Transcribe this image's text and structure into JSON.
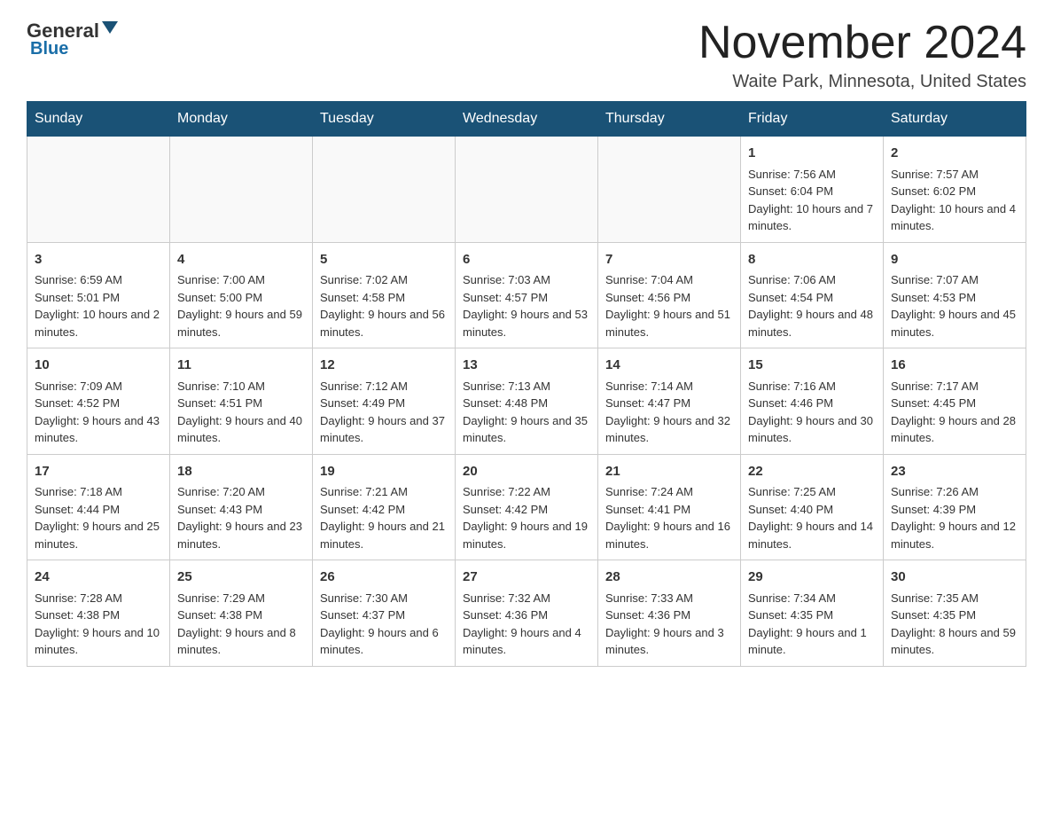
{
  "header": {
    "logo_general": "General",
    "logo_blue": "Blue",
    "month_title": "November 2024",
    "location": "Waite Park, Minnesota, United States"
  },
  "days_of_week": [
    "Sunday",
    "Monday",
    "Tuesday",
    "Wednesday",
    "Thursday",
    "Friday",
    "Saturday"
  ],
  "weeks": [
    [
      {
        "day": "",
        "info": ""
      },
      {
        "day": "",
        "info": ""
      },
      {
        "day": "",
        "info": ""
      },
      {
        "day": "",
        "info": ""
      },
      {
        "day": "",
        "info": ""
      },
      {
        "day": "1",
        "info": "Sunrise: 7:56 AM\nSunset: 6:04 PM\nDaylight: 10 hours and 7 minutes."
      },
      {
        "day": "2",
        "info": "Sunrise: 7:57 AM\nSunset: 6:02 PM\nDaylight: 10 hours and 4 minutes."
      }
    ],
    [
      {
        "day": "3",
        "info": "Sunrise: 6:59 AM\nSunset: 5:01 PM\nDaylight: 10 hours and 2 minutes."
      },
      {
        "day": "4",
        "info": "Sunrise: 7:00 AM\nSunset: 5:00 PM\nDaylight: 9 hours and 59 minutes."
      },
      {
        "day": "5",
        "info": "Sunrise: 7:02 AM\nSunset: 4:58 PM\nDaylight: 9 hours and 56 minutes."
      },
      {
        "day": "6",
        "info": "Sunrise: 7:03 AM\nSunset: 4:57 PM\nDaylight: 9 hours and 53 minutes."
      },
      {
        "day": "7",
        "info": "Sunrise: 7:04 AM\nSunset: 4:56 PM\nDaylight: 9 hours and 51 minutes."
      },
      {
        "day": "8",
        "info": "Sunrise: 7:06 AM\nSunset: 4:54 PM\nDaylight: 9 hours and 48 minutes."
      },
      {
        "day": "9",
        "info": "Sunrise: 7:07 AM\nSunset: 4:53 PM\nDaylight: 9 hours and 45 minutes."
      }
    ],
    [
      {
        "day": "10",
        "info": "Sunrise: 7:09 AM\nSunset: 4:52 PM\nDaylight: 9 hours and 43 minutes."
      },
      {
        "day": "11",
        "info": "Sunrise: 7:10 AM\nSunset: 4:51 PM\nDaylight: 9 hours and 40 minutes."
      },
      {
        "day": "12",
        "info": "Sunrise: 7:12 AM\nSunset: 4:49 PM\nDaylight: 9 hours and 37 minutes."
      },
      {
        "day": "13",
        "info": "Sunrise: 7:13 AM\nSunset: 4:48 PM\nDaylight: 9 hours and 35 minutes."
      },
      {
        "day": "14",
        "info": "Sunrise: 7:14 AM\nSunset: 4:47 PM\nDaylight: 9 hours and 32 minutes."
      },
      {
        "day": "15",
        "info": "Sunrise: 7:16 AM\nSunset: 4:46 PM\nDaylight: 9 hours and 30 minutes."
      },
      {
        "day": "16",
        "info": "Sunrise: 7:17 AM\nSunset: 4:45 PM\nDaylight: 9 hours and 28 minutes."
      }
    ],
    [
      {
        "day": "17",
        "info": "Sunrise: 7:18 AM\nSunset: 4:44 PM\nDaylight: 9 hours and 25 minutes."
      },
      {
        "day": "18",
        "info": "Sunrise: 7:20 AM\nSunset: 4:43 PM\nDaylight: 9 hours and 23 minutes."
      },
      {
        "day": "19",
        "info": "Sunrise: 7:21 AM\nSunset: 4:42 PM\nDaylight: 9 hours and 21 minutes."
      },
      {
        "day": "20",
        "info": "Sunrise: 7:22 AM\nSunset: 4:42 PM\nDaylight: 9 hours and 19 minutes."
      },
      {
        "day": "21",
        "info": "Sunrise: 7:24 AM\nSunset: 4:41 PM\nDaylight: 9 hours and 16 minutes."
      },
      {
        "day": "22",
        "info": "Sunrise: 7:25 AM\nSunset: 4:40 PM\nDaylight: 9 hours and 14 minutes."
      },
      {
        "day": "23",
        "info": "Sunrise: 7:26 AM\nSunset: 4:39 PM\nDaylight: 9 hours and 12 minutes."
      }
    ],
    [
      {
        "day": "24",
        "info": "Sunrise: 7:28 AM\nSunset: 4:38 PM\nDaylight: 9 hours and 10 minutes."
      },
      {
        "day": "25",
        "info": "Sunrise: 7:29 AM\nSunset: 4:38 PM\nDaylight: 9 hours and 8 minutes."
      },
      {
        "day": "26",
        "info": "Sunrise: 7:30 AM\nSunset: 4:37 PM\nDaylight: 9 hours and 6 minutes."
      },
      {
        "day": "27",
        "info": "Sunrise: 7:32 AM\nSunset: 4:36 PM\nDaylight: 9 hours and 4 minutes."
      },
      {
        "day": "28",
        "info": "Sunrise: 7:33 AM\nSunset: 4:36 PM\nDaylight: 9 hours and 3 minutes."
      },
      {
        "day": "29",
        "info": "Sunrise: 7:34 AM\nSunset: 4:35 PM\nDaylight: 9 hours and 1 minute."
      },
      {
        "day": "30",
        "info": "Sunrise: 7:35 AM\nSunset: 4:35 PM\nDaylight: 8 hours and 59 minutes."
      }
    ]
  ]
}
